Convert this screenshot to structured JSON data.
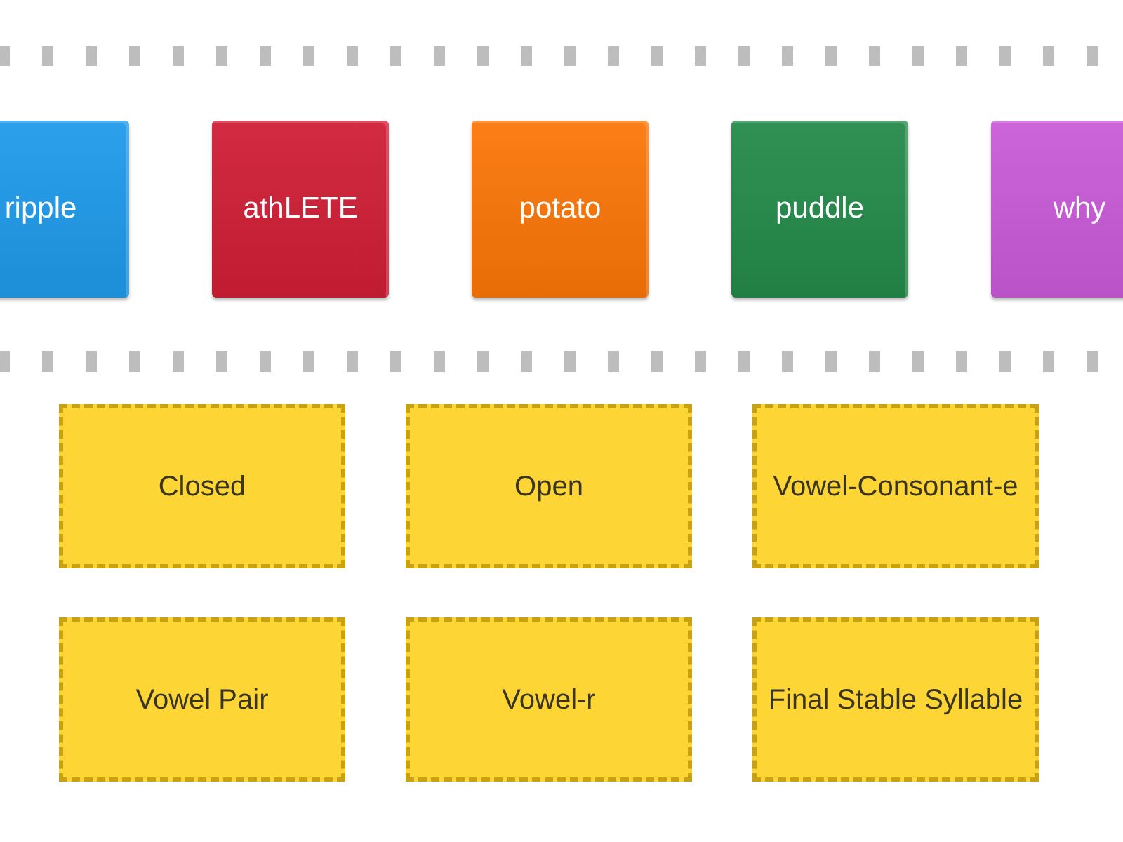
{
  "cards": [
    {
      "label": "ripple",
      "color": "#1f9aea"
    },
    {
      "label": "athLETE",
      "color": "#d01e35"
    },
    {
      "label": "potato",
      "color": "#fb7608"
    },
    {
      "label": "puddle",
      "color": "#248a4a"
    },
    {
      "label": "why",
      "color": "#c95ad8"
    }
  ],
  "categories": [
    {
      "label": "Closed"
    },
    {
      "label": "Open"
    },
    {
      "label": "Vowel-Consonant-e"
    },
    {
      "label": "Vowel Pair"
    },
    {
      "label": "Vowel-r"
    },
    {
      "label": "Final Stable Syllable"
    }
  ]
}
